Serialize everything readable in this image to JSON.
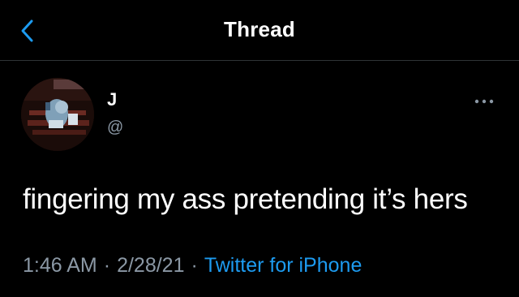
{
  "header": {
    "title": "Thread",
    "back_icon": "chevron-left-icon",
    "accent_color": "#1d9bf0"
  },
  "tweet": {
    "author_name": "J",
    "author_handle": "@",
    "avatar_icon": "avatar-image",
    "more_icon": "more-horizontal-icon",
    "text": "fingering my ass pretending it’s hers",
    "time": "1:46 AM",
    "separator": "·",
    "date": "2/28/21",
    "source": "Twitter for iPhone"
  },
  "colors": {
    "background": "#000000",
    "text": "#ffffff",
    "secondary_text": "#8b98a5",
    "link": "#1d9bf0",
    "divider": "#2f3336"
  }
}
